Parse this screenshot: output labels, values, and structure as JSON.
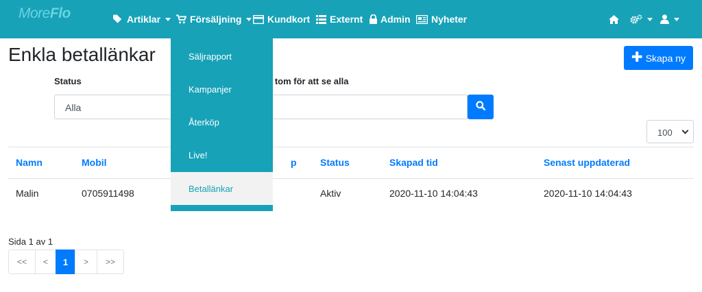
{
  "brand": {
    "text_a": "More",
    "text_b": "Flo"
  },
  "nav": {
    "items": [
      {
        "label": "Artiklar",
        "icon": "tags-icon",
        "dropdown": true
      },
      {
        "label": "Försäljning",
        "icon": "cart-icon",
        "dropdown": true
      },
      {
        "label": "Kundkort",
        "icon": "credit-card-icon",
        "dropdown": false
      },
      {
        "label": "Externt",
        "icon": "list-icon",
        "dropdown": false
      },
      {
        "label": "Admin",
        "icon": "lock-icon",
        "dropdown": false
      },
      {
        "label": "Nyheter",
        "icon": "newspaper-icon",
        "dropdown": false
      }
    ],
    "right_icons": [
      "home-icon",
      "cogs-icon",
      "user-icon"
    ]
  },
  "dropdown": {
    "items": [
      "Säljrapport",
      "Kampanjer",
      "Återköp",
      "Live!",
      "Betallänkar"
    ],
    "active": "Betallänkar"
  },
  "page": {
    "title": "Enkla betallänkar",
    "create_label": "Skapa ny"
  },
  "filters": {
    "status_label": "Status",
    "status_value": "Alla",
    "search_hint": "s tom för att se alla",
    "page_size": "100"
  },
  "table": {
    "headers": [
      "Namn",
      "Mobil",
      "p",
      "Status",
      "Skapad tid",
      "Senast uppdaterad"
    ],
    "rows": [
      {
        "namn": "Malin",
        "mobil": "0705911498",
        "status": "Aktiv",
        "skapad": "2020-11-10 14:04:43",
        "uppdaterad": "2020-11-10 14:04:43"
      }
    ]
  },
  "pagination": {
    "info": "Sida 1 av 1",
    "buttons": [
      "<<",
      "<",
      "1",
      ">",
      ">>"
    ],
    "current": "1"
  },
  "colors": {
    "navbar": "#17a2b8",
    "primary": "#007bff",
    "link": "#007bff"
  }
}
